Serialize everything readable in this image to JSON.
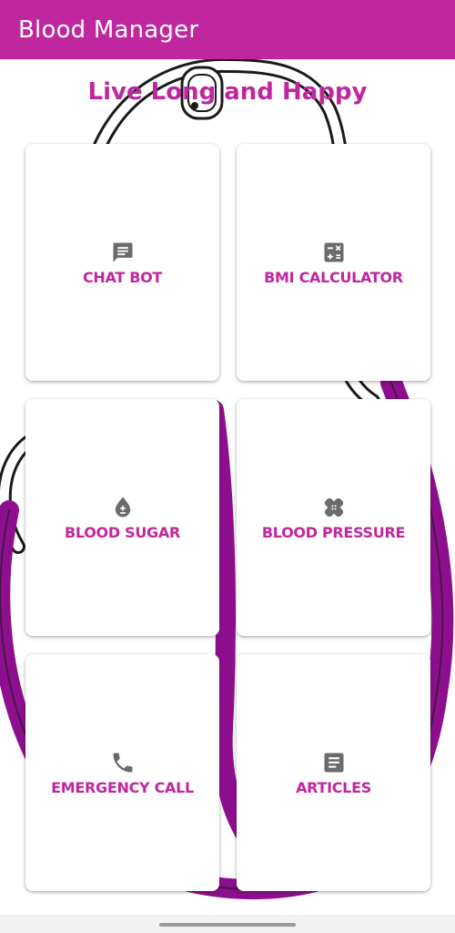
{
  "appbar": {
    "title": "Blood Manager"
  },
  "headline": "Live Long and Happy",
  "colors": {
    "accent": "#c0279f",
    "stethoscope_tube": "#8e0f8e",
    "icon_gray": "#6b6b6b"
  },
  "cards": [
    {
      "label": "CHAT BOT",
      "icon": "chat-icon"
    },
    {
      "label": "BMI CALCULATOR",
      "icon": "calculator-icon"
    },
    {
      "label": "BLOOD SUGAR",
      "icon": "blood-drop-icon"
    },
    {
      "label": "BLOOD PRESSURE",
      "icon": "bandage-icon"
    },
    {
      "label": "EMERGENCY CALL",
      "icon": "phone-icon"
    },
    {
      "label": "ARTICLES",
      "icon": "article-icon"
    }
  ]
}
